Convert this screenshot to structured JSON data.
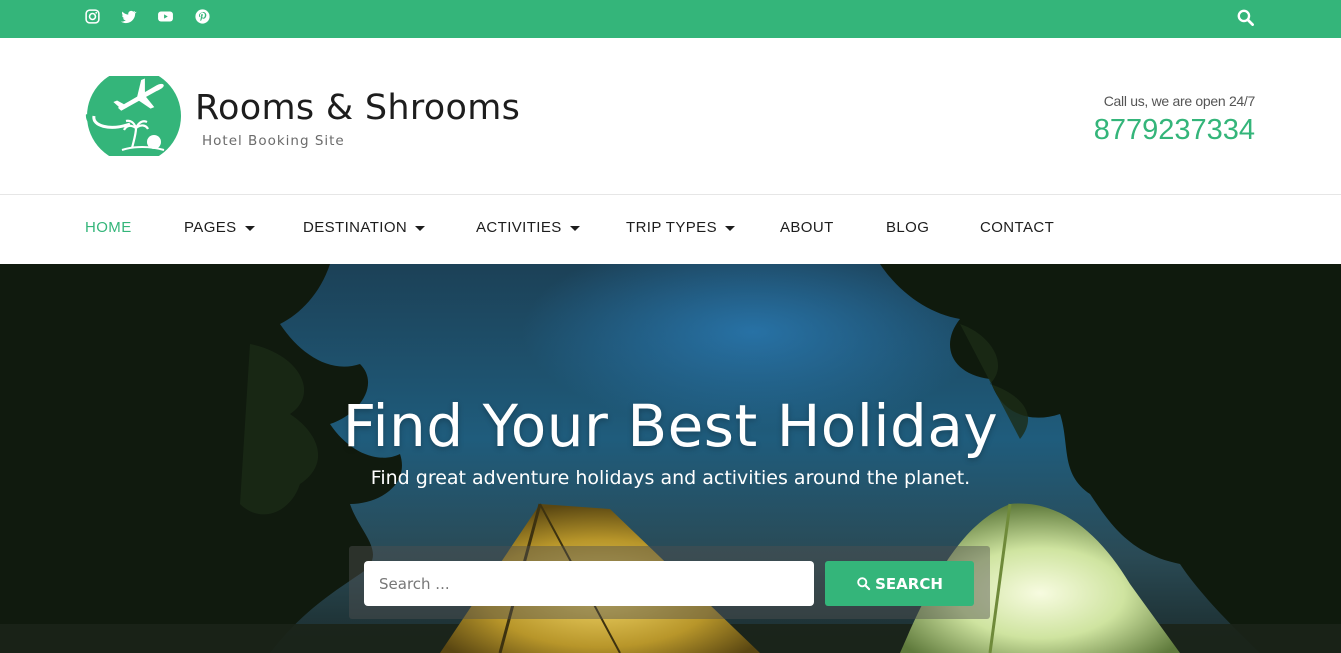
{
  "topbar": {
    "social_icons": [
      "instagram-icon",
      "twitter-icon",
      "youtube-icon",
      "pinterest-icon"
    ],
    "search_icon": "search-icon"
  },
  "header": {
    "site_title": "Rooms & Shrooms",
    "tagline": "Hotel Booking Site",
    "call_text": "Call us, we are open 24/7",
    "phone": "8779237334"
  },
  "nav": {
    "home": "HOME",
    "pages": "PAGES",
    "destination": "DESTINATION",
    "activities": "ACTIVITIES",
    "trip_types": "TRIP TYPES",
    "about": "ABOUT",
    "blog": "BLOG",
    "contact": "CONTACT"
  },
  "hero": {
    "title": "Find Your Best Holiday",
    "subtitle": "Find great adventure holidays and activities around the planet.",
    "search_placeholder": "Search ...",
    "search_button": "SEARCH"
  },
  "colors": {
    "brand_green": "#34b57a",
    "text_dark": "#1d1d1d"
  }
}
